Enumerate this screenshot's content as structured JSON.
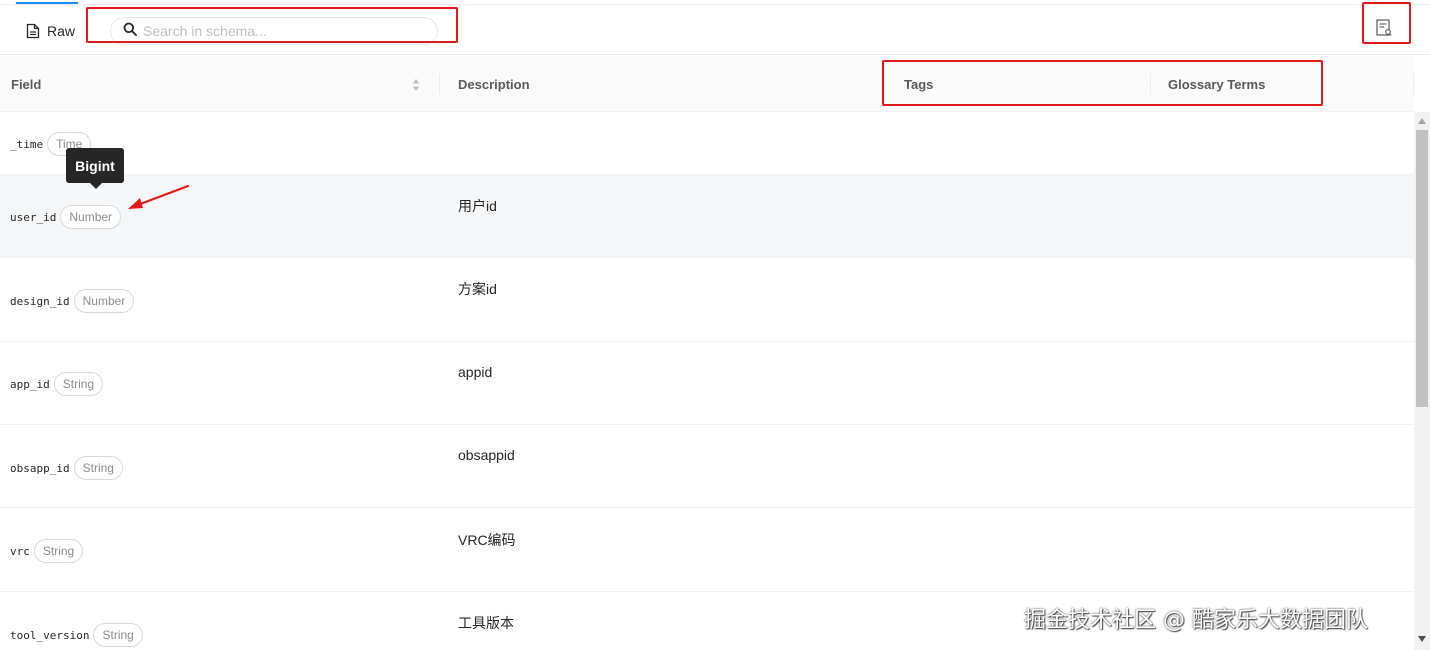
{
  "toolbar": {
    "raw_label": "Raw",
    "search_placeholder": "Search in schema..."
  },
  "columns": {
    "field": "Field",
    "description": "Description",
    "tags": "Tags",
    "glossary_terms": "Glossary Terms"
  },
  "rows": [
    {
      "field": "_time",
      "type": "Time",
      "description": ""
    },
    {
      "field": "user_id",
      "type": "Number",
      "description": "用户id"
    },
    {
      "field": "design_id",
      "type": "Number",
      "description": "方案id"
    },
    {
      "field": "app_id",
      "type": "String",
      "description": "appid"
    },
    {
      "field": "obsapp_id",
      "type": "String",
      "description": "obsappid"
    },
    {
      "field": "vrc",
      "type": "String",
      "description": "VRC编码"
    },
    {
      "field": "tool_version",
      "type": "String",
      "description": "工具版本"
    }
  ],
  "tooltip": {
    "text": "Bigint"
  },
  "watermark": {
    "text": "掘金技术社区 @ 酷家乐大数据团队"
  },
  "colors": {
    "annotation_red": "#e0191b",
    "accent_blue": "#1890ff",
    "hover_row": "#f5f6f7",
    "tooltip_bg": "#262626"
  },
  "icons": {
    "raw": "document-icon",
    "search": "search-icon",
    "schema": "schema-blame-icon",
    "sort": "sort-icon"
  }
}
